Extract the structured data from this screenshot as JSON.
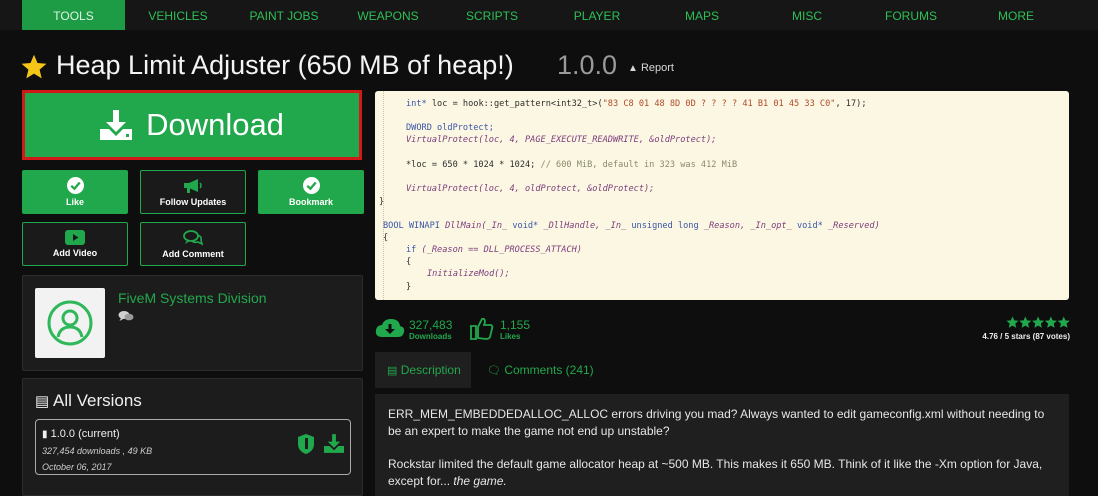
{
  "nav": {
    "items": [
      "TOOLS",
      "VEHICLES",
      "PAINT JOBS",
      "WEAPONS",
      "SCRIPTS",
      "PLAYER",
      "MAPS",
      "MISC",
      "FORUMS",
      "MORE"
    ],
    "active_index": 0
  },
  "mod": {
    "title": "Heap Limit Adjuster (650 MB of heap!)",
    "version": "1.0.0",
    "report_label": "Report"
  },
  "download": {
    "label": "Download"
  },
  "actions": {
    "like": "Like",
    "follow": "Follow Updates",
    "bookmark": "Bookmark",
    "add_video": "Add Video",
    "add_comment": "Add Comment"
  },
  "author": {
    "name": "FiveM Systems Division"
  },
  "versions": {
    "title": "All Versions",
    "items": [
      {
        "name": "1.0.0 (current)",
        "stats": "327,454 downloads , 49 KB",
        "date": "October 06, 2017"
      }
    ]
  },
  "code": {
    "lines": [
      "int* loc = hook::get_pattern<int32_t>(\"83 C8 01 48 8D 0D ? ? ? ? 41 B1 01 45 33 C0\", 17);",
      "DWORD oldProtect;",
      "VirtualProtect(loc, 4, PAGE_EXECUTE_READWRITE, &oldProtect);",
      "*loc = 650 * 1024 * 1024; // 600 MiB, default in 323 was 412 MiB",
      "VirtualProtect(loc, 4, oldProtect, &oldProtect);",
      "}",
      "BOOL WINAPI DllMain(_In_ void* _DllHandle, _In_ unsigned long _Reason, _In_opt_ void* _Reserved)",
      "{",
      "if (_Reason == DLL_PROCESS_ATTACH)",
      "{",
      "InitializeMod();",
      "}"
    ]
  },
  "stats": {
    "downloads": "327,483",
    "downloads_label": "Downloads",
    "likes": "1,155",
    "likes_label": "Likes",
    "rating_text": "4.76 / 5 stars (87 votes)",
    "stars_filled": 5
  },
  "tabs": {
    "description": "Description",
    "comments": "Comments (241)"
  },
  "description": {
    "p1": "ERR_MEM_EMBEDDEDALLOC_ALLOC errors driving you mad? Always wanted to edit gameconfig.xml without needing to be an expert to make the game not end up unstable?",
    "p2_start": "Rockstar limited the default game allocator heap at ~500 MB. This makes it 650 MB. Think of it like the -Xm option for Java, except for...",
    "p2_em": "the game."
  },
  "colors": {
    "accent": "#22a84c",
    "highlight_border": "#d41818",
    "star": "#f5c518"
  }
}
